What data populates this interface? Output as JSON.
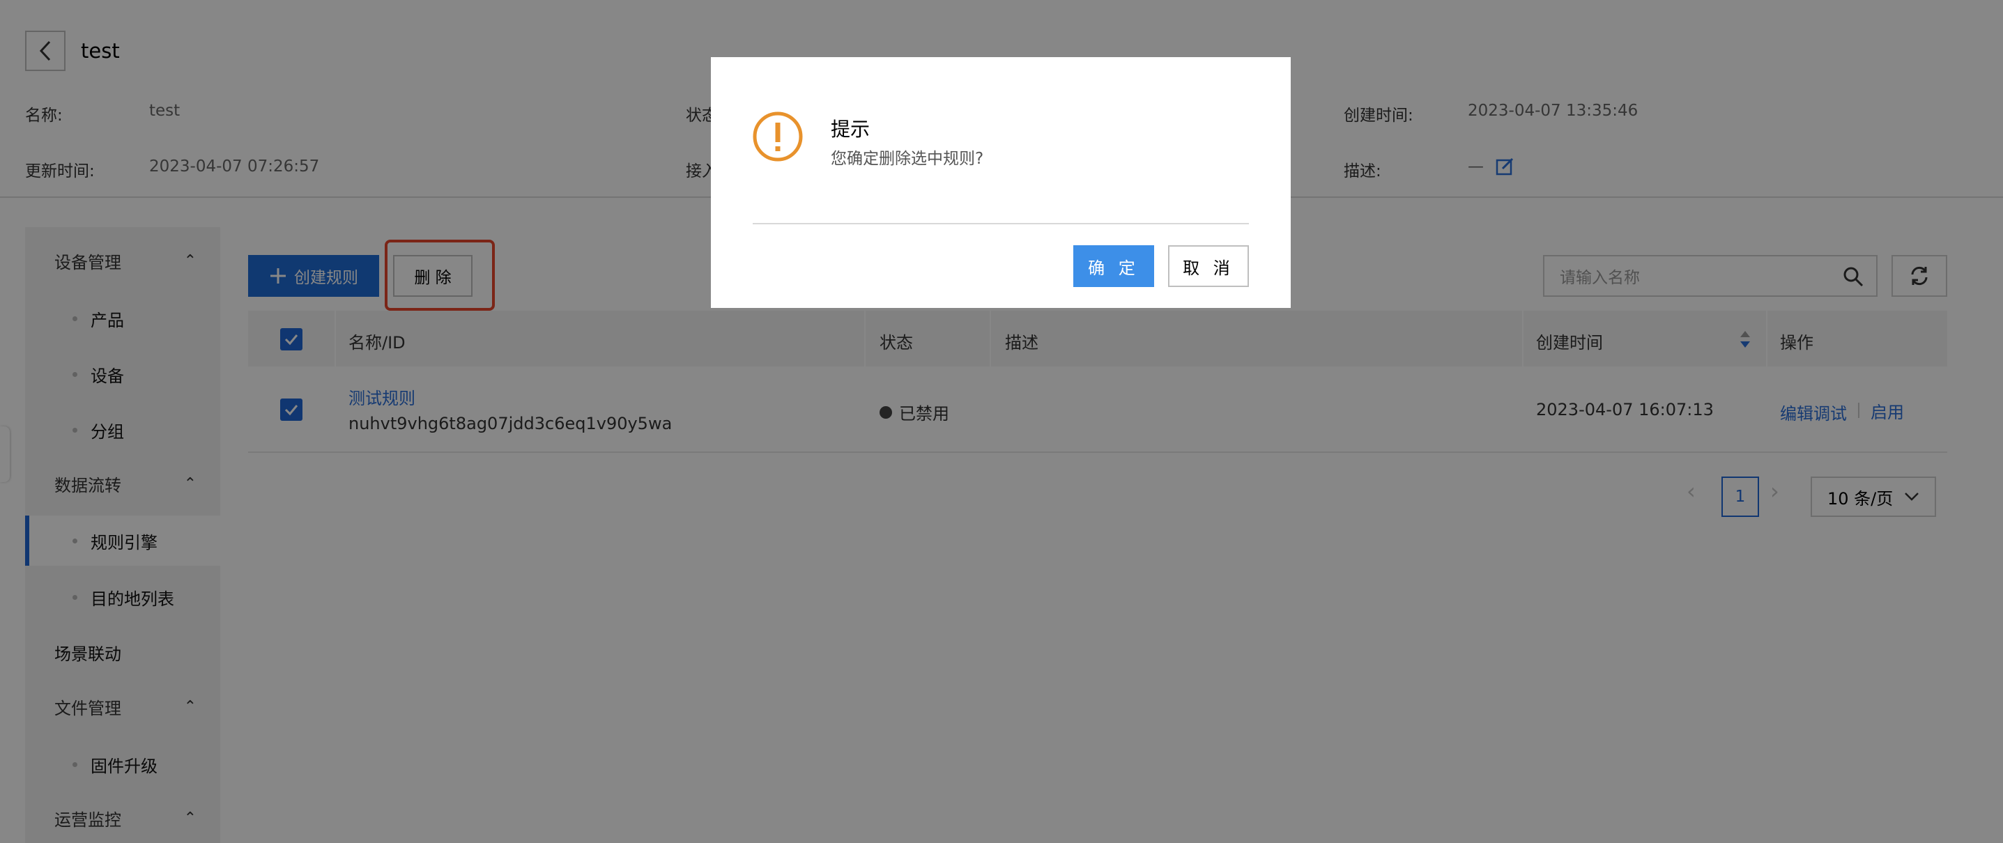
{
  "header": {
    "title": "test"
  },
  "info": {
    "name_label": "名称:",
    "name_value": "test",
    "status_label": "状态",
    "created_label": "创建时间:",
    "created_value": "2023-04-07 13:35:46",
    "updated_label": "更新时间:",
    "updated_value": "2023-04-07 07:26:57",
    "access_label": "接入",
    "desc_label": "描述:",
    "desc_value": "—"
  },
  "sidebar": {
    "groups": [
      {
        "label": "设备管理"
      },
      {
        "label": "数据流转"
      },
      {
        "label": "场景联动"
      },
      {
        "label": "文件管理"
      },
      {
        "label": "运营监控"
      }
    ],
    "items": [
      {
        "label": "产品"
      },
      {
        "label": "设备"
      },
      {
        "label": "分组"
      },
      {
        "label": "规则引擎"
      },
      {
        "label": "目的地列表"
      },
      {
        "label": "固件升级"
      }
    ]
  },
  "toolbar": {
    "create_label": "创建规则",
    "delete_label": "删 除",
    "search_placeholder": "请输入名称"
  },
  "table": {
    "headers": [
      "名称/ID",
      "状态",
      "描述",
      "创建时间",
      "操作"
    ],
    "rows": [
      {
        "name": "测试规则",
        "id": "nuhvt9vhg6t8ag07jdd3c6eq1v90y5wa",
        "status": "已禁用",
        "created": "2023-04-07 16:07:13",
        "action_edit": "编辑调试",
        "action_enable": "启用"
      }
    ]
  },
  "pagination": {
    "current": "1",
    "page_size": "10 条/页"
  },
  "modal": {
    "title": "提示",
    "message": "您确定删除选中规则?",
    "ok_label": "确 定",
    "cancel_label": "取 消"
  },
  "colors": {
    "accent": "#1f66d6",
    "warning": "#e8922c",
    "highlight": "#e8472c"
  }
}
